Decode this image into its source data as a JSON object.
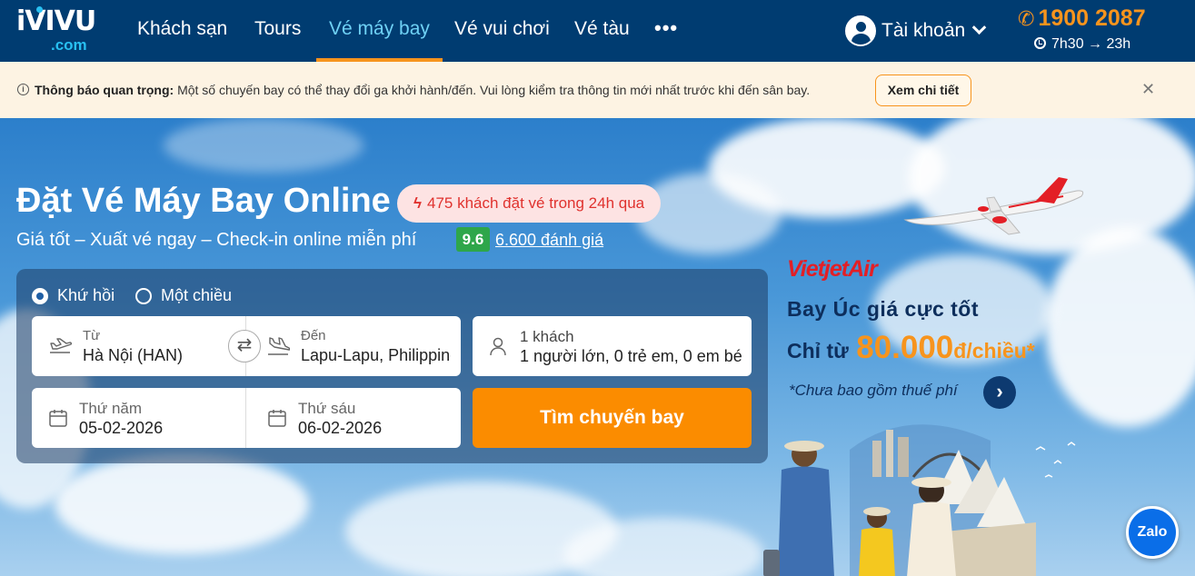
{
  "nav": {
    "logo_main": "iVIVU",
    "logo_sub": ".com",
    "items": [
      "Khách sạn",
      "Tours",
      "Vé máy bay",
      "Vé vui chơi",
      "Vé tàu"
    ],
    "active_index": 2,
    "more": "•••",
    "account_label": "Tài khoản",
    "hotline": "1900 2087",
    "hours": "7h30 → 23h"
  },
  "notice": {
    "title": "Thông báo quan trọng:",
    "message": " Một số chuyến bay có thể thay đổi ga khởi hành/đến. Vui lòng kiểm tra thông tin mới nhất trước khi đến sân bay.",
    "detail_button": "Xem chi tiết",
    "close": "✕"
  },
  "hero": {
    "title": "Đặt Vé Máy Bay Online",
    "bookings_badge": "475 khách đặt vé trong 24h qua",
    "subtitle": "Giá tốt – Xuất vé ngay – Check-in online miễn phí",
    "rating_score": "9.6",
    "rating_count": "6.600 đánh giá"
  },
  "search": {
    "trip_types": [
      "Khứ hồi",
      "Một chiều"
    ],
    "selected_trip": 0,
    "from_label": "Từ",
    "from_value": "Hà Nội (HAN)",
    "to_label": "Đến",
    "to_value": "Lapu-Lapu, Philippines",
    "passengers_label": "1 khách",
    "passengers_value": "1 người lớn, 0 trẻ em, 0 em bé",
    "depart_label": "Thứ năm",
    "depart_value": "05-02-2026",
    "return_label": "Thứ sáu",
    "return_value": "06-02-2026",
    "search_button": "Tìm chuyến bay"
  },
  "promo": {
    "airline": "VietjetAir",
    "title": "Bay Úc giá cực tốt",
    "price_prefix": "Chỉ từ",
    "price": "80.000",
    "price_suffix": "đ/chiều*",
    "note": "*Chưa bao gồm thuế phí"
  },
  "zalo_label": "Zalo",
  "colors": {
    "nav_bg": "#003c71",
    "accent_orange": "#f7941d",
    "active_blue": "#6fd1f5",
    "search_button": "#fb8c00",
    "rating_green": "#2ea64a",
    "vietjet_red": "#e31f26"
  }
}
